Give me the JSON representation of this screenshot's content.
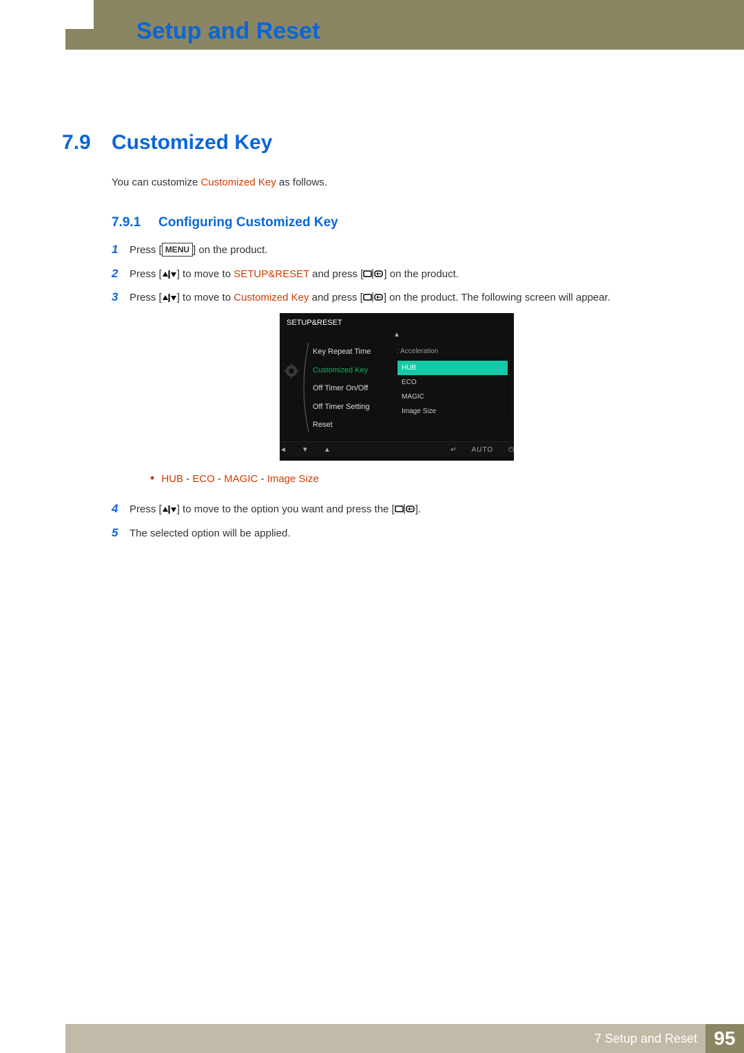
{
  "header": {
    "title": "Setup and Reset"
  },
  "section": {
    "num": "7.9",
    "title": "Customized Key"
  },
  "intro": {
    "pre": "You can customize ",
    "hl": "Customized Key",
    "post": " as follows."
  },
  "sub": {
    "num": "7.9.1",
    "title": "Configuring Customized Key"
  },
  "steps": {
    "s1": {
      "n": "1",
      "a": "Press [",
      "menu": "MENU",
      "b": "] on the product."
    },
    "s2": {
      "n": "2",
      "a": "Press [",
      "b": "] to move to ",
      "hl": "SETUP&RESET",
      "c": " and press [",
      "d": "] on the product."
    },
    "s3": {
      "n": "3",
      "a": "Press [",
      "b": "] to move to ",
      "hl": "Customized Key",
      "c": " and press [",
      "d": "] on the product. The following screen will appear."
    },
    "s4": {
      "n": "4",
      "a": "Press [",
      "b": "] to move to the option you want and press the [",
      "c": "]."
    },
    "s5": {
      "n": "5",
      "text": "The selected option will be applied."
    }
  },
  "osd": {
    "title": "SETUP&RESET",
    "left": {
      "l1": "Key Repeat Time",
      "l2": "Customized Key",
      "l3": "Off Timer On/Off",
      "l4": "Off Timer Setting",
      "l5": "Reset"
    },
    "accel": ": Acceleration",
    "opts": {
      "o1": "HUB",
      "o2": "ECO",
      "o3": "MAGIC",
      "o4": "Image Size"
    },
    "auto": "AUTO"
  },
  "bullet": {
    "h": "HUB",
    "sep": " - ",
    "e": "ECO",
    "m": "MAGIC",
    "i": "Image Size"
  },
  "footer": {
    "text": "7 Setup and Reset",
    "page": "95"
  }
}
